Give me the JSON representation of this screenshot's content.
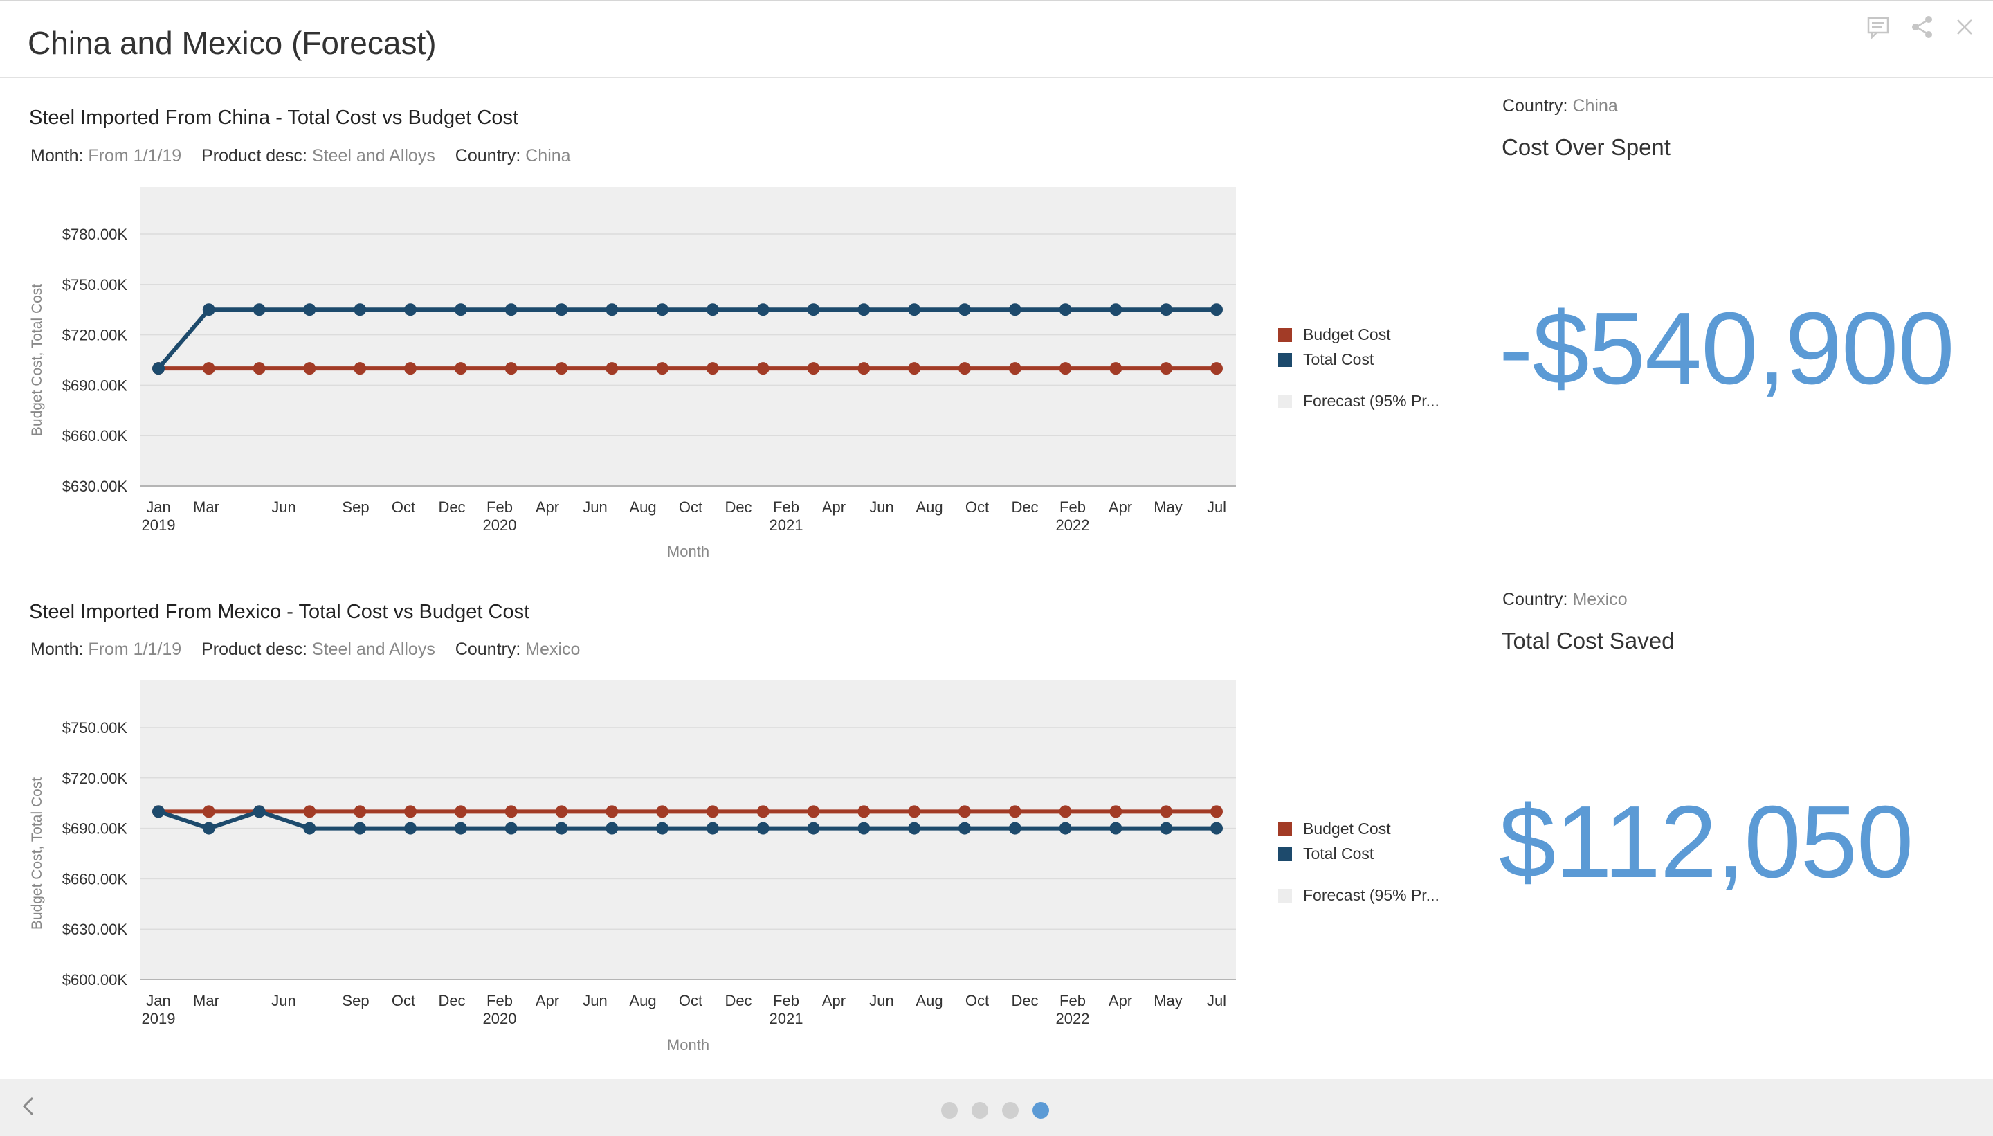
{
  "header": {
    "title": "China and Mexico (Forecast)",
    "icons": [
      "comment-icon",
      "share-icon",
      "close-icon"
    ]
  },
  "colors": {
    "budget": "#a23b26",
    "total": "#1d4a6c",
    "forecast": "#ededed",
    "plot_bg": "#efefef",
    "grid": "#dcdcdc",
    "kpi": "#5b9ad5",
    "dot_inactive": "#cfcfcf",
    "dot_active": "#5b9ad5"
  },
  "months_axis": {
    "ticks": [
      "Jan",
      "Mar",
      "Jun",
      "Sep",
      "Oct",
      "Dec",
      "Feb",
      "Apr",
      "Jun",
      "Aug",
      "Oct",
      "Dec",
      "Feb",
      "Apr",
      "Jun",
      "Aug",
      "Oct",
      "Dec",
      "Feb",
      "Apr",
      "May",
      "Jul"
    ],
    "years": [
      "2019",
      "2020",
      "2021",
      "2022"
    ]
  },
  "charts": [
    {
      "title": "Steel Imported From China - Total Cost vs Budget Cost",
      "filters": [
        {
          "key": "Month:",
          "value": "From 1/1/19"
        },
        {
          "key": "Product desc:",
          "value": "Steel and Alloys"
        },
        {
          "key": "Country:",
          "value": "China"
        }
      ],
      "legend": [
        "Budget Cost",
        "Total Cost",
        "Forecast (95% Pr..."
      ]
    },
    {
      "title": "Steel Imported From Mexico - Total Cost vs Budget Cost",
      "filters": [
        {
          "key": "Month:",
          "value": "From 1/1/19"
        },
        {
          "key": "Product desc:",
          "value": "Steel and Alloys"
        },
        {
          "key": "Country:",
          "value": "Mexico"
        }
      ],
      "legend": [
        "Budget Cost",
        "Total Cost",
        "Forecast (95% Pr..."
      ]
    }
  ],
  "chart_data": [
    {
      "type": "line",
      "title": "Steel Imported From China - Total Cost vs Budget Cost",
      "xlabel": "Month",
      "ylabel": "Budget Cost, Total Cost",
      "x": [
        "Jan 2019",
        "Mar 2019",
        "Jun 2019",
        "Sep 2019",
        "Oct 2019",
        "Dec 2019",
        "Feb 2020",
        "Apr 2020",
        "Jun 2020",
        "Aug 2020",
        "Oct 2020",
        "Dec 2020",
        "Feb 2021",
        "Apr 2021",
        "Jun 2021",
        "Aug 2021",
        "Oct 2021",
        "Dec 2021",
        "Feb 2022",
        "Apr 2022",
        "May 2022",
        "Jul 2022"
      ],
      "y_ticks": [
        "$780.00K",
        "$750.00K",
        "$720.00K",
        "$690.00K",
        "$660.00K",
        "$630.00K"
      ],
      "ylim": [
        630,
        780
      ],
      "series": [
        {
          "name": "Budget Cost",
          "values": [
            700,
            700,
            700,
            700,
            700,
            700,
            700,
            700,
            700,
            700,
            700,
            700,
            700,
            700,
            700,
            700,
            700,
            700,
            700,
            700,
            700,
            700
          ]
        },
        {
          "name": "Total Cost",
          "values": [
            700,
            735,
            735,
            735,
            735,
            735,
            735,
            735,
            735,
            735,
            735,
            735,
            735,
            735,
            735,
            735,
            735,
            735,
            735,
            735,
            735,
            735
          ]
        }
      ],
      "legend": [
        "Budget Cost",
        "Total Cost",
        "Forecast (95% Pr..."
      ]
    },
    {
      "type": "line",
      "title": "Steel Imported From Mexico - Total Cost vs Budget Cost",
      "xlabel": "Month",
      "ylabel": "Budget Cost, Total Cost",
      "x": [
        "Jan 2019",
        "Mar 2019",
        "Jun 2019",
        "Sep 2019",
        "Oct 2019",
        "Dec 2019",
        "Feb 2020",
        "Apr 2020",
        "Jun 2020",
        "Aug 2020",
        "Oct 2020",
        "Dec 2020",
        "Feb 2021",
        "Apr 2021",
        "Jun 2021",
        "Aug 2021",
        "Oct 2021",
        "Dec 2021",
        "Feb 2022",
        "Apr 2022",
        "May 2022",
        "Jul 2022"
      ],
      "y_ticks": [
        "$750.00K",
        "$720.00K",
        "$690.00K",
        "$660.00K",
        "$630.00K",
        "$600.00K"
      ],
      "ylim": [
        600,
        750
      ],
      "series": [
        {
          "name": "Budget Cost",
          "values": [
            700,
            700,
            700,
            700,
            700,
            700,
            700,
            700,
            700,
            700,
            700,
            700,
            700,
            700,
            700,
            700,
            700,
            700,
            700,
            700,
            700,
            700
          ]
        },
        {
          "name": "Total Cost",
          "values": [
            700,
            690,
            700,
            690,
            690,
            690,
            690,
            690,
            690,
            690,
            690,
            690,
            690,
            690,
            690,
            690,
            690,
            690,
            690,
            690,
            690,
            690
          ]
        }
      ],
      "legend": [
        "Budget Cost",
        "Total Cost",
        "Forecast (95% Pr..."
      ]
    }
  ],
  "kpis": [
    {
      "country_key": "Country:",
      "country_value": "China",
      "title": "Cost Over Spent",
      "value": "-$540,900"
    },
    {
      "country_key": "Country:",
      "country_value": "Mexico",
      "title": "Total Cost Saved",
      "value": "$112,050"
    }
  ],
  "footer": {
    "pages": 4,
    "active_page": 4
  }
}
